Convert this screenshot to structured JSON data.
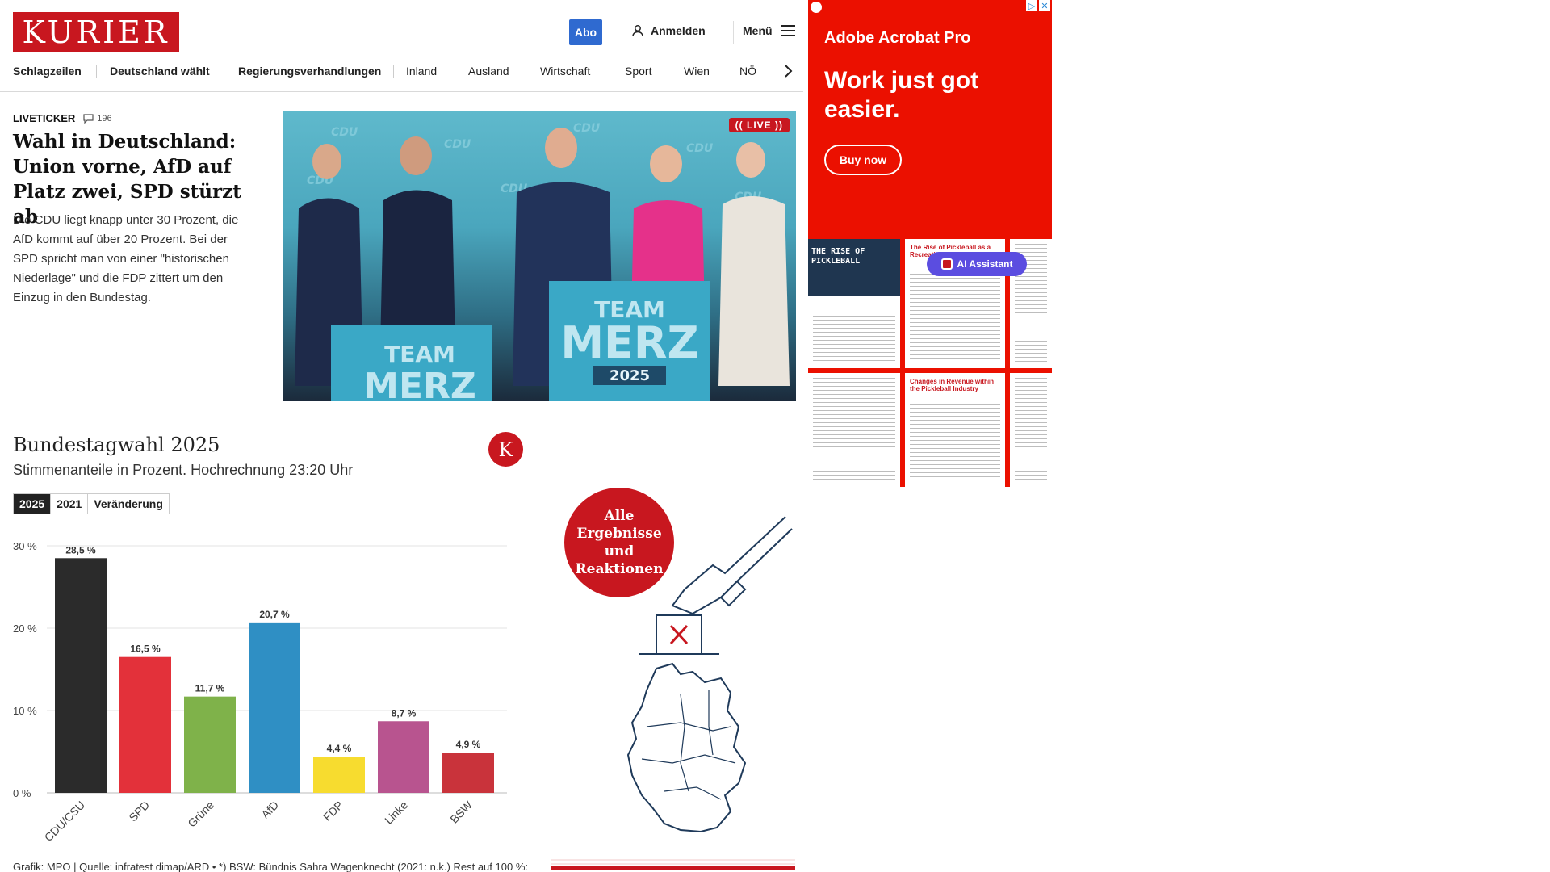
{
  "header": {
    "logo_text": "KURIER",
    "abo_label": "Abo",
    "login_label": "Anmelden",
    "menu_label": "Menü",
    "nav": [
      "Schlagzeilen",
      "Deutschland wählt",
      "Regierungsverhandlungen",
      "Inland",
      "Ausland",
      "Wirtschaft",
      "Sport",
      "Wien",
      "NÖ"
    ]
  },
  "lead": {
    "kicker": "LIVETICKER",
    "comment_count": "196",
    "headline": "Wahl in Deutschland: Union vorne, AfD auf Platz zwei, SPD stürzt ab",
    "teaser": "Die CDU liegt knapp unter 30 Prozent, die AfD kommt auf über 20 Prozent. Bei der SPD spricht man von einer \"historischen Niederlage\" und die FDP zittert um den Einzug in den Bundestag.",
    "live_badge": "(( LIVE ))",
    "sign_team": "TEAM",
    "sign_merz": "MERZ",
    "sign_year": "2025",
    "backdrop_text": "CDU"
  },
  "chart_widget": {
    "title": "Bundestagwahl 2025",
    "subtitle": "Stimmenanteile in Prozent. Hochrechnung 23:20 Uhr",
    "badge": "K",
    "tabs": [
      "2025",
      "2021",
      "Veränderung"
    ],
    "active_tab": 0,
    "source": "Grafik: MPO | Quelle: infratest dimap/ARD • *) BSW: Bündnis Sahra Wagenknecht (2021: n.k.) Rest auf 100 %:"
  },
  "chart_data": {
    "type": "bar",
    "categories": [
      "CDU/CSU",
      "SPD",
      "Grüne",
      "AfD",
      "FDP",
      "Linke",
      "BSW"
    ],
    "values": [
      28.5,
      16.5,
      11.7,
      20.7,
      4.4,
      8.7,
      4.9
    ],
    "value_labels": [
      "28,5 %",
      "16,5 %",
      "11,7 %",
      "20,7 %",
      "4,4 %",
      "8,7 %",
      "4,9 %"
    ],
    "colors": [
      "#2b2b2b",
      "#e3313a",
      "#7fb24a",
      "#2f8fc4",
      "#f7dc2f",
      "#b8548f",
      "#c9333b"
    ],
    "yticks": [
      0,
      10,
      20,
      30
    ],
    "ytick_labels": [
      "0 %",
      "10 %",
      "20 %",
      "30 %"
    ],
    "ylim": [
      0,
      30
    ],
    "grid": true,
    "title": "Bundestagwahl 2025",
    "xlabel": "",
    "ylabel": ""
  },
  "promo": {
    "circle_text": "Alle Ergebnisse und Reaktionen"
  },
  "ad": {
    "brand": "Adobe Acrobat Pro",
    "headline": "Work just got easier.",
    "cta": "Buy now",
    "doc1_title": "THE RISE OF PICKLEBALL",
    "doc2_title": "The Rise of Pickleball as a Recreational Sport",
    "doc3_title": "Changes in Revenue within the Pickleball Industry",
    "ai_pill": "AI Assistant",
    "colors": {
      "background": "#eb1000",
      "pill": "#5b4de0"
    }
  }
}
